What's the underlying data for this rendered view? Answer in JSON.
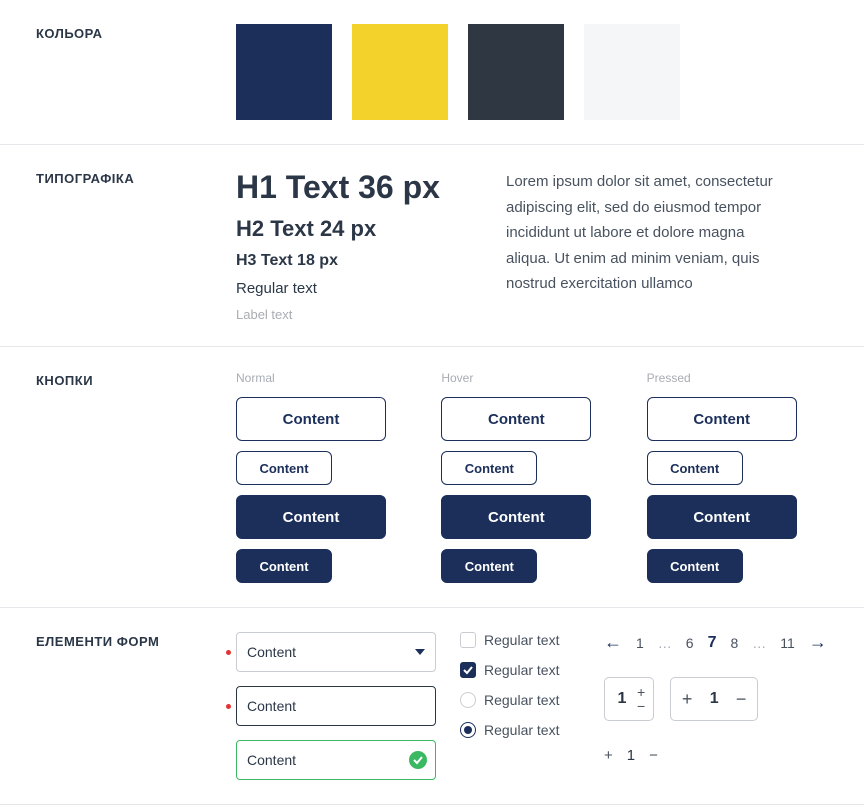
{
  "sections": {
    "colors": {
      "label": "КОЛЬОРА"
    },
    "typography": {
      "label": "ТИПОГРАФІКА"
    },
    "buttons": {
      "label": "КНОПКИ"
    },
    "forms": {
      "label": "ЕЛЕМЕНТИ ФОРМ"
    }
  },
  "colors": [
    {
      "hex": "#1b2f5a"
    },
    {
      "hex": "#f3d22c"
    },
    {
      "hex": "#2f3743"
    },
    {
      "hex": "#f4f6f8"
    }
  ],
  "typography": {
    "h1": "H1 Text 36 px",
    "h2": "H2 Text 24 px",
    "h3": "H3 Text 18 px",
    "regular": "Regular text",
    "label": "Label text",
    "lorem": "Lorem ipsum dolor sit amet, consectetur adipiscing elit, sed do eiusmod tempor incididunt ut labore et dolore magna aliqua. Ut enim ad minim veniam, quis nostrud exercitation ullamco"
  },
  "buttons": {
    "states": {
      "normal": "Normal",
      "hover": "Hover",
      "pressed": "Pressed"
    },
    "label": "Content"
  },
  "forms": {
    "select_value": "Content",
    "option_label": "Regular text",
    "pagination": {
      "pages": [
        "1",
        "6",
        "7",
        "8",
        "11"
      ],
      "active": "7"
    },
    "stepper_value": "1"
  }
}
